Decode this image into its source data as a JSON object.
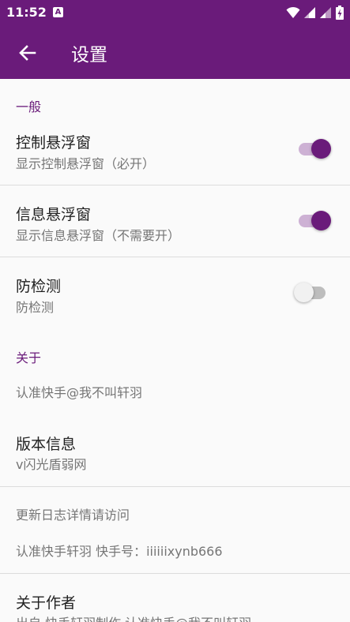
{
  "status_bar": {
    "time": "11:52",
    "notification_icon_letter": "A",
    "icons": [
      "wifi-icon",
      "signal-icon",
      "signal-icon",
      "battery-charging-icon"
    ]
  },
  "app_bar": {
    "title": "设置",
    "back_icon": "arrow-back-icon"
  },
  "colors": {
    "primary": "#6a1b7a",
    "background": "#fafafa",
    "divider": "#dcdcdc",
    "title_text": "#212121",
    "summary_text": "#757575"
  },
  "general": {
    "category": "一般",
    "items": [
      {
        "title": "控制悬浮窗",
        "summary": "显示控制悬浮窗（必开）",
        "checked": true
      },
      {
        "title": "信息悬浮窗",
        "summary": "显示信息悬浮窗（不需要开）",
        "checked": true
      },
      {
        "title": "防检测",
        "summary": "防检测",
        "checked": false
      }
    ]
  },
  "about": {
    "category": "关于",
    "note": "认准快手@我不叫轩羽",
    "version": {
      "title": "版本信息",
      "summary": "v闪光盾弱网"
    },
    "update_log": "更新日志详情请访问",
    "contact": "认准快手轩羽 快手号：iiiiiixynb666",
    "author": {
      "title": "关于作者",
      "summary": "出自 快手轩羽制作 认准快手@我不叫轩羽"
    }
  }
}
